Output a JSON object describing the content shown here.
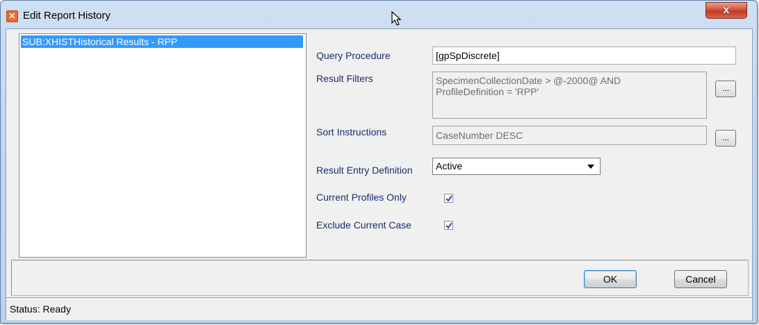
{
  "window": {
    "title": "Edit Report History",
    "close_label": "x"
  },
  "list": {
    "items": [
      {
        "label": "SUB:XHISTHistorical Results - RPP",
        "selected": true
      }
    ]
  },
  "form": {
    "query_procedure": {
      "label": "Query Procedure",
      "value": "[gpSpDiscrete]"
    },
    "result_filters": {
      "label": "Result Filters",
      "value_line1": "SpecimenCollectionDate >  @-2000@  AND",
      "value_line2": "ProfileDefinition = 'RPP'",
      "button_label": "..."
    },
    "sort_instructions": {
      "label": "Sort Instructions",
      "value": "CaseNumber DESC",
      "button_label": "..."
    },
    "result_entry_definition": {
      "label": "Result Entry Definition",
      "selected": "Active"
    },
    "current_profiles_only": {
      "label": "Current Profiles Only",
      "checked": true
    },
    "exclude_current_case": {
      "label": "Exclude Current Case",
      "checked": true
    }
  },
  "buttons": {
    "ok": "OK",
    "cancel": "Cancel"
  },
  "status": {
    "text": "Status: Ready"
  },
  "icons": {
    "app": "app-logo-icon",
    "cursor": "mouse-cursor-icon",
    "check": "checkmark-icon",
    "dropdown": "chevron-down-icon"
  },
  "colors": {
    "selection": "#3399ff",
    "label_text": "#1a2b6e",
    "close_button": "#c03a22"
  }
}
